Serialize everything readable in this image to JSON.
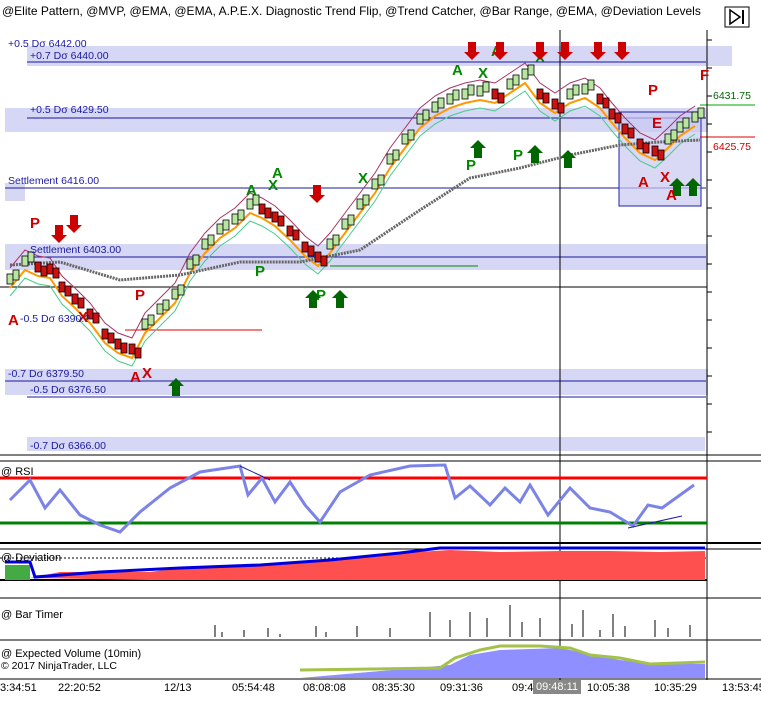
{
  "title": "@Elite Pattern, @MVP, @EMA, @EMA, A.P.E.X. Diagnostic Trend Flip, @Trend Catcher, @Bar Range, @EMA, @Deviation Levels",
  "toolbar": {
    "play_icon": "play-pause-icon"
  },
  "levels": [
    {
      "label": "+0.5 Dσ 6442.00"
    },
    {
      "label": "+0.7 Dσ 6440.00"
    },
    {
      "label": "+0.5 Dσ 6429.50"
    },
    {
      "label": "Settlement 6416.00"
    },
    {
      "label": "Settlement 6403.00"
    },
    {
      "label": "-0.5 Dσ 6390.?"
    },
    {
      "label": "-0.7 Dσ 6379.50"
    },
    {
      "label": "-0.5 Dσ 6376.50"
    },
    {
      "label": "-0.7 Dσ 6366.00"
    }
  ],
  "price_markers": {
    "upper": "6431.75",
    "lower": "6425.75"
  },
  "panels": {
    "rsi": "@ RSI",
    "deviation": "@ Deviation",
    "bar_timer": "@ Bar Timer",
    "expected_volume": "@ Expected Volume (10min)"
  },
  "copyright": "© 2017 NinjaTrader, LLC",
  "x_axis": [
    "3:34:51",
    "22:20:52",
    "12/13",
    "05:54:48",
    "08:08:08",
    "08:35:30",
    "09:31:36",
    "09:4",
    "10:05:38",
    "10:35:29",
    "13:53:45"
  ],
  "crosshair_time": "09:48:11",
  "signals": {
    "a": "A",
    "x": "X",
    "p": "P",
    "e": "E",
    "f": "F"
  },
  "colors": {
    "level_band": "#d6d6f5",
    "up_bar": "#b8e6a0",
    "down_bar": "#cc1111",
    "rsi_line": "#7b84e6",
    "overbought": "#ff0000",
    "oversold": "#008000",
    "deviation": "#ff5050",
    "volume": "#8f8fff",
    "volume_line": "#a4c24a"
  }
}
